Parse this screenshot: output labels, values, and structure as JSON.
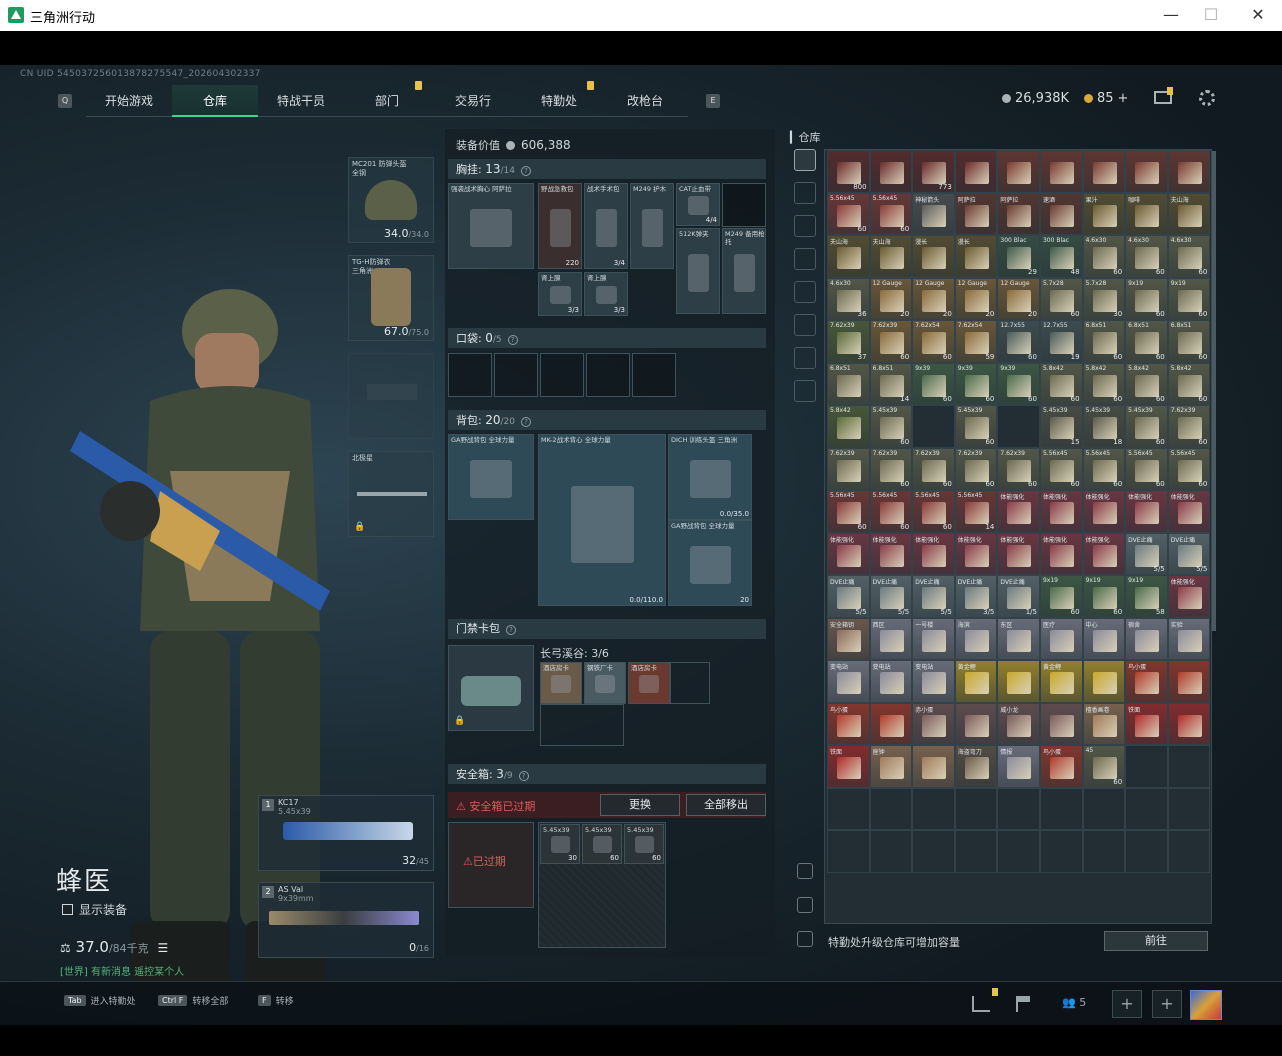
{
  "window": {
    "title": "三角洲行动",
    "minimize": "—",
    "maximize": "☐",
    "close": "✕"
  },
  "uid": "CN UID 545037256013878275547_202604302337",
  "nav": {
    "left_key": "Q",
    "right_key": "E",
    "tabs": [
      {
        "label": "开始游戏",
        "active": false,
        "badge": false
      },
      {
        "label": "仓库",
        "active": true,
        "badge": false
      },
      {
        "label": "特战干员",
        "active": false,
        "badge": false
      },
      {
        "label": "部门",
        "active": false,
        "badge": true
      },
      {
        "label": "交易行",
        "active": false,
        "badge": false
      },
      {
        "label": "特勤处",
        "active": false,
        "badge": true
      },
      {
        "label": "改枪台",
        "active": false,
        "badge": false
      }
    ]
  },
  "currency": {
    "silver": "26,938K",
    "gold": "85",
    "plus": "+"
  },
  "character": {
    "name": "蜂医",
    "show_equipment": "显示装备",
    "weight": "37.0",
    "weight_max": "/84千克",
    "hint": "[世界] 有新消息 遥控某个人"
  },
  "equip": {
    "helmet": {
      "label": "MC201 防弹头盔",
      "sub": "全钢",
      "value": "34.0",
      "max": "/34.0"
    },
    "armor": {
      "label": "TG-H防弹衣",
      "sub": "三角洲",
      "value": "67.0",
      "max": "/75.0"
    },
    "melee": {
      "label": "北极星"
    },
    "primary": {
      "num": "1",
      "label": "KC17",
      "sub": "5.45x39",
      "ammo": "32",
      "ammo_max": "/45"
    },
    "secondary": {
      "num": "2",
      "label": "AS Val",
      "sub": "9x39mm",
      "ammo": "0",
      "ammo_max": "/16"
    }
  },
  "loadout": {
    "value_label": "装备价值",
    "value": "606,388",
    "chest": {
      "title": "胸挂:",
      "count": "13",
      "max": "/14"
    },
    "chest_items": [
      {
        "label": "强袭战术胸心 阿萨拉",
        "cnt": ""
      },
      {
        "label": "野战急救包",
        "cnt": "220"
      },
      {
        "label": "战术手术包",
        "cnt": "3/4"
      },
      {
        "label": "M249 护木",
        "cnt": ""
      },
      {
        "label": "CAT止血带",
        "cnt": "4/4"
      },
      {
        "label": "512K弹夹",
        "cnt": ""
      },
      {
        "label": "M249 备用枪托",
        "cnt": ""
      },
      {
        "label": "肾上腺",
        "cnt": "3/3"
      },
      {
        "label": "肾上腺",
        "cnt": "3/3"
      }
    ],
    "pocket": {
      "title": "口袋:",
      "count": "0",
      "max": "/5"
    },
    "backpack": {
      "title": "背包:",
      "count": "20",
      "max": "/20"
    },
    "backpack_items": [
      {
        "label": "GA野战背包 全球力量",
        "cnt": ""
      },
      {
        "label": "MK-2战术背心 全球力量",
        "cnt": "0.0/110.0"
      },
      {
        "label": "DICH 训练头盔 三角洲",
        "cnt": "0.0/35.0"
      },
      {
        "label": "GA野战背包 全球力量",
        "cnt": "20"
      }
    ],
    "keycard": {
      "title": "门禁卡包",
      "zone": "长弓溪谷: 3/6"
    },
    "keycard_items": [
      {
        "label": "酒店房卡"
      },
      {
        "label": "钢铁厂卡"
      },
      {
        "label": "酒店房卡"
      }
    ],
    "safebox": {
      "title": "安全箱:",
      "count": "3",
      "max": "/9",
      "warn": "安全箱已过期",
      "expired": "已过期",
      "swap": "更换",
      "remove_all": "全部移出"
    },
    "safebox_items": [
      {
        "label": "5.45x39",
        "cnt": "30"
      },
      {
        "label": "5.45x39",
        "cnt": "60"
      },
      {
        "label": "5.45x39",
        "cnt": "60"
      }
    ]
  },
  "warehouse": {
    "title": "仓库",
    "footer": "特勤处升级仓库可增加容量",
    "go": "前往",
    "cells": [
      {
        "l": "",
        "c": "800",
        "col": "#6a2a2a"
      },
      {
        "l": "",
        "c": "",
        "col": "#6a2a2a"
      },
      {
        "l": "",
        "c": "773",
        "col": "#6a2a2a"
      },
      {
        "l": "",
        "c": "",
        "col": "#6a2a2a"
      },
      {
        "l": "",
        "c": "",
        "col": "#7a3a30"
      },
      {
        "l": "",
        "c": "",
        "col": "#7a3a30"
      },
      {
        "l": "",
        "c": "",
        "col": "#7a3a30"
      },
      {
        "l": "",
        "c": "",
        "col": "#7a3a30"
      },
      {
        "l": "",
        "c": "",
        "col": "#7a3a30"
      },
      {
        "l": "5.56x45",
        "c": "60",
        "col": "#8a3a38"
      },
      {
        "l": "5.56x45",
        "c": "60",
        "col": "#8a3a38"
      },
      {
        "l": "神秘箭头",
        "c": "",
        "col": "#5a5a5a"
      },
      {
        "l": "阿萨拉",
        "c": "",
        "col": "#6a3a30"
      },
      {
        "l": "阿萨拉",
        "c": "",
        "col": "#6a3a30"
      },
      {
        "l": "速酒",
        "c": "",
        "col": "#6a3a30"
      },
      {
        "l": "果汁",
        "c": "",
        "col": "#6a5a30"
      },
      {
        "l": "咖啡",
        "c": "",
        "col": "#6a5a30"
      },
      {
        "l": "夫山海",
        "c": "",
        "col": "#6a5a30"
      },
      {
        "l": "夫山海",
        "c": "",
        "col": "#6a5a30"
      },
      {
        "l": "夫山海",
        "c": "",
        "col": "#6a5a30"
      },
      {
        "l": "漫长",
        "c": "",
        "col": "#6a5a30"
      },
      {
        "l": "漫长",
        "c": "",
        "col": "#6a5a30"
      },
      {
        "l": "300 Blac",
        "c": "29",
        "col": "#3f5a4a"
      },
      {
        "l": "300 Blac",
        "c": "48",
        "col": "#3f5a4a"
      },
      {
        "l": "4.6x30",
        "c": "60",
        "col": "#6a6a50"
      },
      {
        "l": "4.6x30",
        "c": "60",
        "col": "#6a6a50"
      },
      {
        "l": "4.6x30",
        "c": "60",
        "col": "#6a6a50"
      },
      {
        "l": "4.6x30",
        "c": "36",
        "col": "#6a6a50"
      },
      {
        "l": "12 Gauge",
        "c": "20",
        "col": "#8a6a3a"
      },
      {
        "l": "12 Gauge",
        "c": "20",
        "col": "#8a6a3a"
      },
      {
        "l": "12 Gauge",
        "c": "20",
        "col": "#8a6a3a"
      },
      {
        "l": "12 Gauge",
        "c": "20",
        "col": "#8a6a3a"
      },
      {
        "l": "5.7x28",
        "c": "60",
        "col": "#6a6a50"
      },
      {
        "l": "5.7x28",
        "c": "30",
        "col": "#6a6a50"
      },
      {
        "l": "9x19",
        "c": "60",
        "col": "#6a6a50"
      },
      {
        "l": "9x19",
        "c": "60",
        "col": "#6a6a50"
      },
      {
        "l": "7.62x39",
        "c": "37",
        "col": "#5a6a3a"
      },
      {
        "l": "7.62x39",
        "c": "60",
        "col": "#8a6a3a"
      },
      {
        "l": "7.62x54",
        "c": "60",
        "col": "#8a6a3a"
      },
      {
        "l": "7.62x54",
        "c": "59",
        "col": "#8a6a3a"
      },
      {
        "l": "12.7x55",
        "c": "60",
        "col": "#4a5a5a"
      },
      {
        "l": "12.7x55",
        "c": "19",
        "col": "#4a5a5a"
      },
      {
        "l": "6.8x51",
        "c": "60",
        "col": "#6a6a50"
      },
      {
        "l": "6.8x51",
        "c": "60",
        "col": "#6a6a50"
      },
      {
        "l": "6.8x51",
        "c": "60",
        "col": "#6a6a50"
      },
      {
        "l": "6.8x51",
        "c": "",
        "col": "#6a6a50"
      },
      {
        "l": "6.8x51",
        "c": "14",
        "col": "#6a6a50"
      },
      {
        "l": "9x39",
        "c": "60",
        "col": "#4a6a4a"
      },
      {
        "l": "9x39",
        "c": "60",
        "col": "#4a6a4a"
      },
      {
        "l": "9x39",
        "c": "60",
        "col": "#4a6a4a"
      },
      {
        "l": "5.8x42",
        "c": "60",
        "col": "#6a6a50"
      },
      {
        "l": "5.8x42",
        "c": "60",
        "col": "#6a6a50"
      },
      {
        "l": "5.8x42",
        "c": "60",
        "col": "#6a6a50"
      },
      {
        "l": "5.8x42",
        "c": "60",
        "col": "#6a6a50"
      },
      {
        "l": "5.8x42",
        "c": "",
        "col": "#5a6a3a"
      },
      {
        "l": "5.45x39",
        "c": "60",
        "col": "#6a6a50"
      },
      {
        "l": "",
        "c": "",
        "col": ""
      },
      {
        "l": "5.45x39",
        "c": "60",
        "col": "#6a6a50"
      },
      {
        "l": "",
        "c": "",
        "col": ""
      },
      {
        "l": "5.45x39",
        "c": "15",
        "col": "#5a5a4a"
      },
      {
        "l": "5.45x39",
        "c": "18",
        "col": "#5a5a4a"
      },
      {
        "l": "5.45x39",
        "c": "60",
        "col": "#6a6a50"
      },
      {
        "l": "7.62x39",
        "c": "60",
        "col": "#6a6a50"
      },
      {
        "l": "7.62x39",
        "c": "",
        "col": "#6a6a50"
      },
      {
        "l": "7.62x39",
        "c": "60",
        "col": "#6a6a50"
      },
      {
        "l": "7.62x39",
        "c": "60",
        "col": "#6a6a50"
      },
      {
        "l": "7.62x39",
        "c": "60",
        "col": "#6a6a50"
      },
      {
        "l": "7.62x39",
        "c": "60",
        "col": "#6a6a50"
      },
      {
        "l": "5.56x45",
        "c": "60",
        "col": "#6a6a50"
      },
      {
        "l": "5.56x45",
        "c": "60",
        "col": "#6a6a50"
      },
      {
        "l": "5.56x45",
        "c": "60",
        "col": "#6a6a50"
      },
      {
        "l": "5.56x45",
        "c": "60",
        "col": "#6a6a50"
      },
      {
        "l": "5.56x45",
        "c": "60",
        "col": "#8a3a38"
      },
      {
        "l": "5.56x45",
        "c": "60",
        "col": "#8a3a38"
      },
      {
        "l": "5.56x45",
        "c": "60",
        "col": "#8a3a38"
      },
      {
        "l": "5.56x45",
        "c": "14",
        "col": "#8a3a38"
      },
      {
        "l": "体能强化",
        "c": "",
        "col": "#8a3a48"
      },
      {
        "l": "体能强化",
        "c": "",
        "col": "#8a3a48"
      },
      {
        "l": "体能强化",
        "c": "",
        "col": "#8a3a48"
      },
      {
        "l": "体能强化",
        "c": "",
        "col": "#8a3a48"
      },
      {
        "l": "体能强化",
        "c": "",
        "col": "#8a3a48"
      },
      {
        "l": "体能强化",
        "c": "",
        "col": "#8a3a48"
      },
      {
        "l": "体能强化",
        "c": "",
        "col": "#8a3a48"
      },
      {
        "l": "体能强化",
        "c": "",
        "col": "#8a3a48"
      },
      {
        "l": "体能强化",
        "c": "",
        "col": "#8a3a48"
      },
      {
        "l": "体能强化",
        "c": "",
        "col": "#8a3a48"
      },
      {
        "l": "体能强化",
        "c": "",
        "col": "#8a3a48"
      },
      {
        "l": "体能强化",
        "c": "",
        "col": "#8a3a48"
      },
      {
        "l": "DVE止痛",
        "c": "5/5",
        "col": "#6a7a80"
      },
      {
        "l": "DVE止痛",
        "c": "5/5",
        "col": "#6a7a80"
      },
      {
        "l": "DVE止痛",
        "c": "5/5",
        "col": "#6a7a80"
      },
      {
        "l": "DVE止痛",
        "c": "5/5",
        "col": "#6a7a80"
      },
      {
        "l": "DVE止痛",
        "c": "5/5",
        "col": "#6a7a80"
      },
      {
        "l": "DVE止痛",
        "c": "3/5",
        "col": "#6a7a80"
      },
      {
        "l": "DVE止痛",
        "c": "1/5",
        "col": "#6a7a80"
      },
      {
        "l": "9x19",
        "c": "60",
        "col": "#4a6a4a"
      },
      {
        "l": "9x19",
        "c": "60",
        "col": "#4a6a4a"
      },
      {
        "l": "9x19",
        "c": "58",
        "col": "#4a6a4a"
      },
      {
        "l": "体能强化",
        "c": "",
        "col": "#8a3a48"
      },
      {
        "l": "安全箱钥",
        "c": "",
        "col": "#8a6a5a"
      },
      {
        "l": "西区",
        "c": "",
        "col": "#8a8a9a"
      },
      {
        "l": "一号楼",
        "c": "",
        "col": "#8a8a9a"
      },
      {
        "l": "海滨",
        "c": "",
        "col": "#8a8a9a"
      },
      {
        "l": "东区",
        "c": "",
        "col": "#8a8a9a"
      },
      {
        "l": "医疗",
        "c": "",
        "col": "#8a8a9a"
      },
      {
        "l": "中心",
        "c": "",
        "col": "#8a8a9a"
      },
      {
        "l": "宿舍",
        "c": "",
        "col": "#8a8a9a"
      },
      {
        "l": "实验",
        "c": "",
        "col": "#8a8a9a"
      },
      {
        "l": "变电站",
        "c": "",
        "col": "#8a8a9a"
      },
      {
        "l": "变电站",
        "c": "",
        "col": "#8a8a9a"
      },
      {
        "l": "变电站",
        "c": "",
        "col": "#8a8a9a"
      },
      {
        "l": "黄金鲤",
        "c": "",
        "col": "#c8a82a"
      },
      {
        "l": "",
        "c": "",
        "col": "#c8a82a"
      },
      {
        "l": "黄金鲤",
        "c": "",
        "col": "#c8a82a"
      },
      {
        "l": "",
        "c": "",
        "col": "#c8a82a"
      },
      {
        "l": "鸟小蛋",
        "c": "",
        "col": "#b03a2a"
      },
      {
        "l": "",
        "c": "",
        "col": "#b03a2a"
      },
      {
        "l": "鸟小蛋",
        "c": "",
        "col": "#b03a2a"
      },
      {
        "l": "",
        "c": "",
        "col": "#b03a2a"
      },
      {
        "l": "赤小蛋",
        "c": "",
        "col": "#7a5a5a"
      },
      {
        "l": "",
        "c": "",
        "col": "#7a5a5a"
      },
      {
        "l": "威小龙",
        "c": "",
        "col": "#7a5a5a"
      },
      {
        "l": "",
        "c": "",
        "col": "#7a5a5a"
      },
      {
        "l": "檀香画卷",
        "c": "",
        "col": "#a07a5a"
      },
      {
        "l": "铁面",
        "c": "",
        "col": "#b02a2a"
      },
      {
        "l": "",
        "c": "",
        "col": "#b02a2a"
      },
      {
        "l": "铁面",
        "c": "",
        "col": "#b02a2a"
      },
      {
        "l": "座钟",
        "c": "",
        "col": "#a07a5a"
      },
      {
        "l": "",
        "c": "",
        "col": "#a07a5a"
      },
      {
        "l": "海盗弯刀",
        "c": "",
        "col": "#6a5a4a"
      },
      {
        "l": "情报",
        "c": "",
        "col": "#8a8a9a"
      },
      {
        "l": "鸟小蛋",
        "c": "",
        "col": "#b03a2a"
      },
      {
        "l": "45",
        "c": "60",
        "col": "#6a6a50"
      },
      {
        "l": "",
        "c": "",
        "col": ""
      },
      {
        "l": "",
        "c": "",
        "col": ""
      },
      {
        "l": "",
        "c": "",
        "col": ""
      },
      {
        "l": "",
        "c": "",
        "col": ""
      },
      {
        "l": "",
        "c": "",
        "col": ""
      },
      {
        "l": "",
        "c": "",
        "col": ""
      },
      {
        "l": "",
        "c": "",
        "col": ""
      },
      {
        "l": "",
        "c": "",
        "col": ""
      },
      {
        "l": "",
        "c": "",
        "col": ""
      },
      {
        "l": "",
        "c": "",
        "col": ""
      },
      {
        "l": "",
        "c": "",
        "col": ""
      },
      {
        "l": "",
        "c": "",
        "col": ""
      },
      {
        "l": "",
        "c": "",
        "col": ""
      },
      {
        "l": "",
        "c": "",
        "col": ""
      },
      {
        "l": "",
        "c": "",
        "col": ""
      },
      {
        "l": "",
        "c": "",
        "col": ""
      },
      {
        "l": "",
        "c": "",
        "col": ""
      },
      {
        "l": "",
        "c": "",
        "col": ""
      },
      {
        "l": "",
        "c": "",
        "col": ""
      },
      {
        "l": "",
        "c": "",
        "col": ""
      }
    ]
  },
  "bottom": {
    "keys": [
      {
        "k": "Tab",
        "t": "进入特勤处"
      },
      {
        "k": "Ctrl F",
        "t": "转移全部"
      },
      {
        "k": "F",
        "t": "转移"
      }
    ],
    "squad_count": "5"
  },
  "colors": {
    "accent": "#3fd08b",
    "warning": "#e05a5a",
    "badge": "#e8c14a"
  }
}
